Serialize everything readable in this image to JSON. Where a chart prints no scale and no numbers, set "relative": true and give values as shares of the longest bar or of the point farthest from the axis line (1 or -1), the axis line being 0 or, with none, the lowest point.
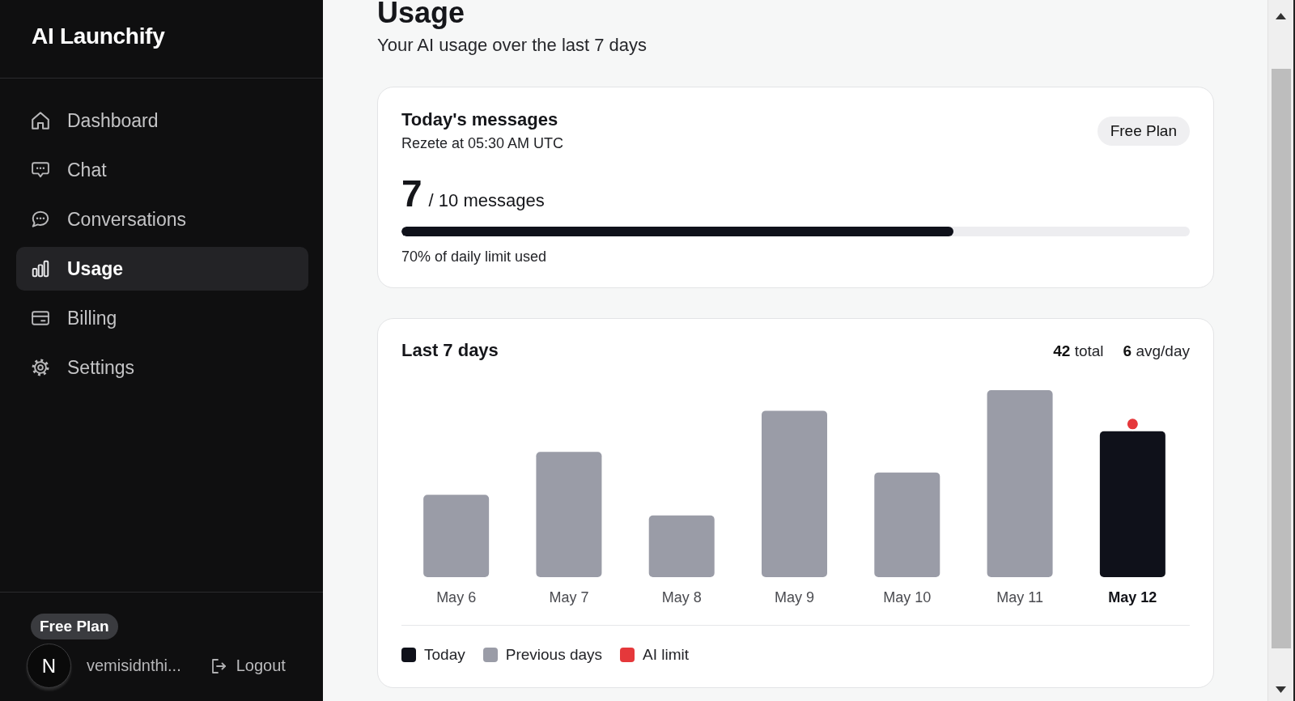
{
  "sidebar": {
    "brand": "AI Launchify",
    "nav": [
      {
        "label": "Dashboard",
        "selected": false
      },
      {
        "label": "Chat",
        "selected": false
      },
      {
        "label": "Conversations",
        "selected": false
      },
      {
        "label": "Usage",
        "selected": true
      },
      {
        "label": "Billing",
        "selected": false
      },
      {
        "label": "Settings",
        "selected": false
      }
    ],
    "plan_badge": "Free Plan",
    "user": {
      "avatar_initial": "N",
      "name": "vemisidnthi..."
    },
    "logout": "Logout"
  },
  "header": {
    "title": "Usage",
    "subtitle": "Your AI usage over the last 7 days"
  },
  "today_card": {
    "title": "Today's messages",
    "reset_note": "Rezete at 05:30 AM UTC",
    "plan_badge": "Free Plan",
    "count": "7",
    "limit": "/ 10 messages",
    "progress": {
      "level": 0.7
    },
    "caption": "70% of daily limit used"
  },
  "history_card": {
    "title": "Last 7 days",
    "total": "**42** total",
    "average": "**6** avg/day",
    "chart_data": {
      "type": "bar",
      "relative": true,
      "categories": [
        "May 6",
        "May 7",
        "May 8",
        "May 9",
        "May 10",
        "May 11",
        "May 12"
      ],
      "series": [
        {
          "name": "Today",
          "color": "#0f111a",
          "values": [
            null,
            null,
            null,
            null,
            null,
            null,
            0.78
          ]
        },
        {
          "name": "Previous days",
          "color": "#9a9ca7",
          "values": [
            0.44,
            0.67,
            0.33,
            0.89,
            0.56,
            1.0,
            null
          ]
        }
      ],
      "stacked": true
    },
    "limit_marker": {
      "label": "AI limit",
      "color": "#e5383b"
    }
  }
}
